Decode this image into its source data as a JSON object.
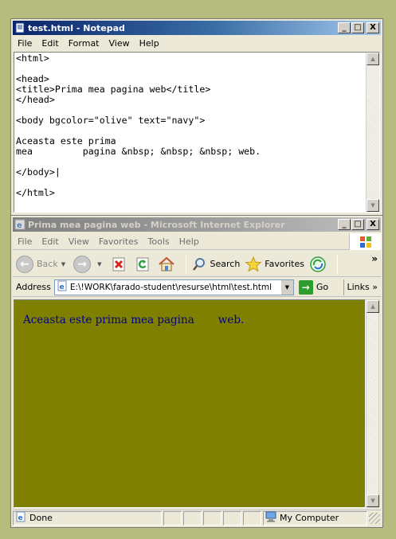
{
  "notepad": {
    "title": "test.html - Notepad",
    "menu": [
      "File",
      "Edit",
      "Format",
      "View",
      "Help"
    ],
    "text": "<html>\n\n<head>\n<title>Prima mea pagina web</title>\n</head>\n\n<body bgcolor=\"olive\" text=\"navy\">\n\nAceasta este prima\nmea         pagina &nbsp; &nbsp; &nbsp; web.\n\n</body>|\n\n</html>"
  },
  "ie": {
    "title": "Prima mea pagina web - Microsoft Internet Explorer",
    "menu": [
      "File",
      "Edit",
      "View",
      "Favorites",
      "Tools",
      "Help"
    ],
    "toolbar": {
      "back_label": "Back",
      "search_label": "Search",
      "favorites_label": "Favorites",
      "chevron": "»"
    },
    "address": {
      "label": "Address",
      "value": "E:\\!WORK\\farado-student\\resurse\\html\\test.html",
      "go_label": "Go",
      "links_label": "Links"
    },
    "page": {
      "text": "Aceasta este prima mea pagina       web.",
      "background": "#808000",
      "text_color": "#000080"
    },
    "status": {
      "left": "Done",
      "zone": "My Computer"
    }
  },
  "caption": {
    "minimize": "_",
    "maximize": "□",
    "close": "X"
  }
}
